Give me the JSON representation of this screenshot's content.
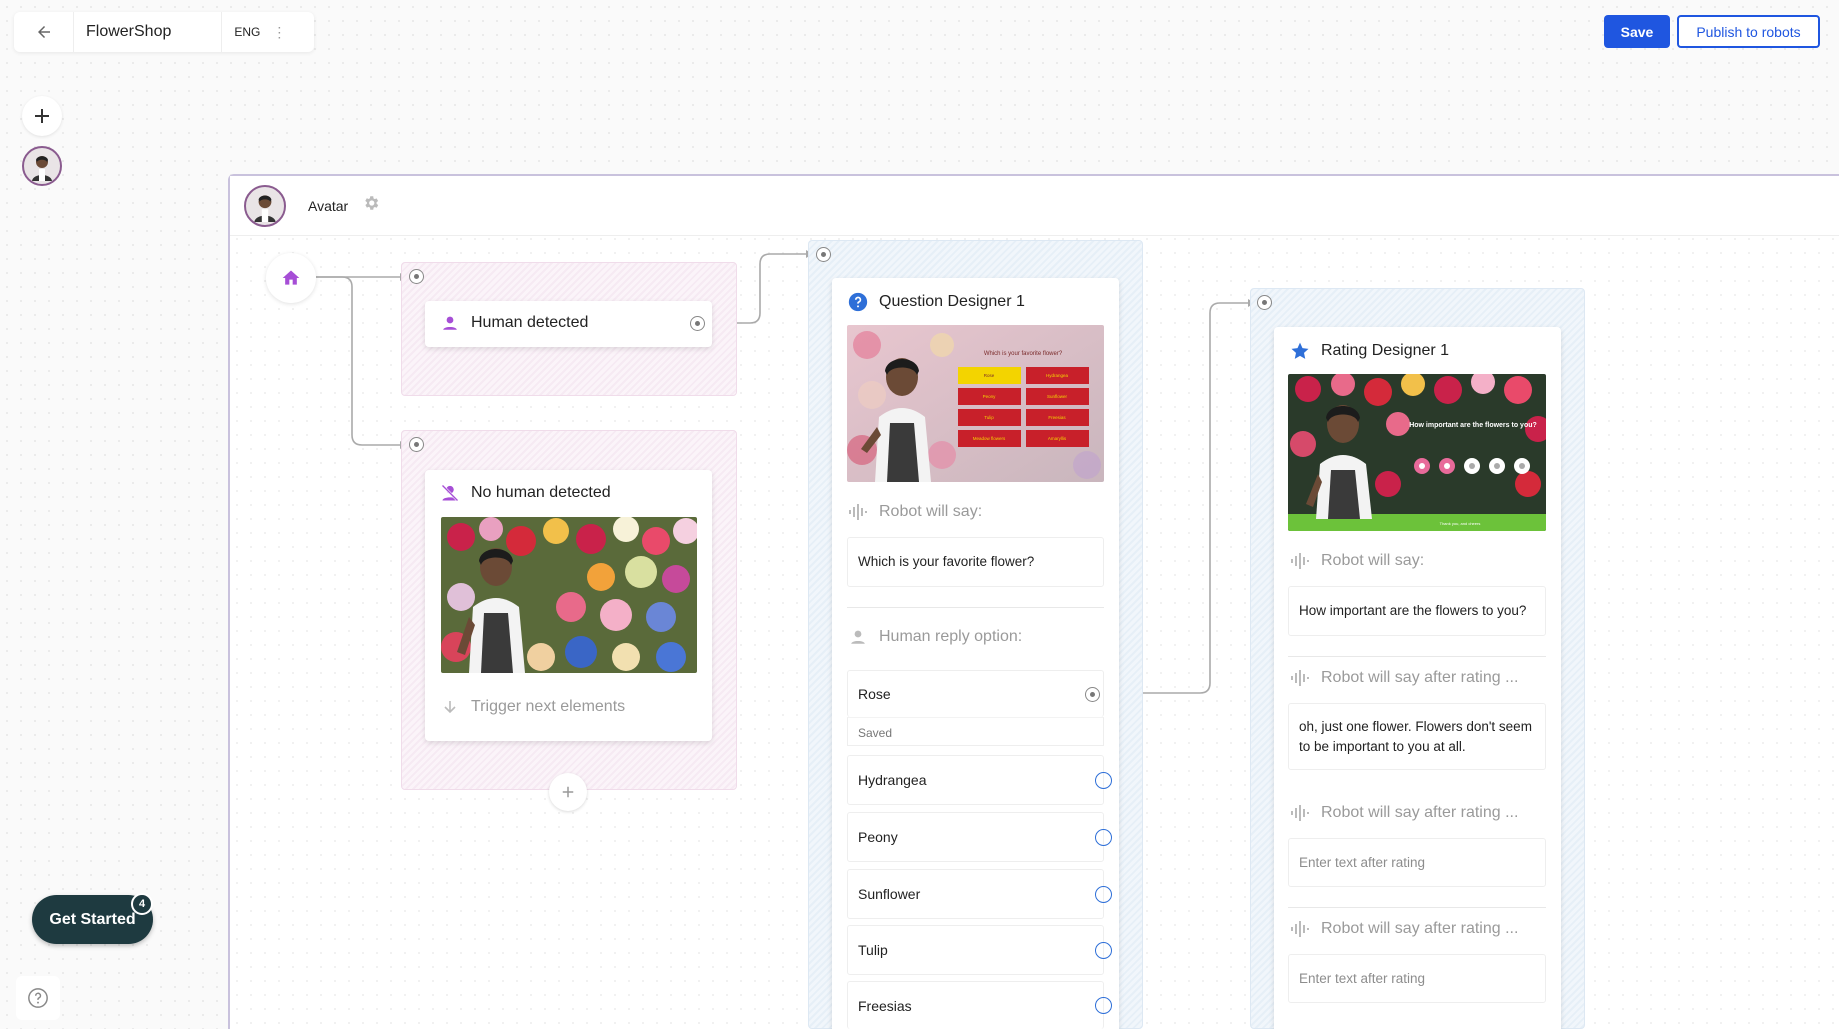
{
  "app": {
    "title": "FlowerShop",
    "language": "ENG",
    "more_glyph": "⋮",
    "save_label": "Save",
    "publish_label": "Publish to robots"
  },
  "canvas": {
    "header_label": "Avatar"
  },
  "nodes": {
    "human_detected": {
      "title": "Human detected"
    },
    "no_human_detected": {
      "title": "No human detected",
      "trigger_label": "Trigger next elements"
    },
    "question_designer": {
      "title": "Question Designer 1",
      "image": {
        "heading": "Which is your favorite flower?",
        "tiles": [
          "Rose",
          "Hydrangea",
          "Peony",
          "Sunflower",
          "Tulip",
          "Freesias",
          "Meadow flowers",
          "Amaryllis"
        ]
      },
      "robot_say_label": "Robot will say:",
      "robot_say_text": "Which is your favorite flower?",
      "human_reply_label": "Human reply option:",
      "options": [
        "Rose",
        "Hydrangea",
        "Peony",
        "Sunflower",
        "Tulip",
        "Freesias"
      ],
      "saved_label": "Saved"
    },
    "rating_designer": {
      "title": "Rating Designer 1",
      "image": {
        "heading": "How important are the flowers to you?",
        "footer": "Thank you, and cheers"
      },
      "robot_say_label": "Robot will say:",
      "robot_say_text": "How important are the flowers to you?",
      "after_rating_label": "Robot will say after rating ...",
      "after_rating_1_text": "oh, just one flower. Flowers don't seem to be important to you at all.",
      "after_rating_placeholder": "Enter text after rating"
    }
  },
  "get_started": {
    "label": "Get Started",
    "count": "4"
  },
  "colors": {
    "primary": "#1f56e0",
    "accent_purple": "#a64ed6",
    "question_blue": "#2e6fd8",
    "dark_pill": "#1e3a40",
    "canvas_border": "#c9c2dd"
  },
  "icons": [
    "back-arrow-icon",
    "plus-icon",
    "avatar-icon",
    "gear-icon",
    "home-icon",
    "person-icon",
    "person-off-icon",
    "question-icon",
    "star-icon",
    "sound-wave-icon",
    "arrow-down-icon",
    "help-icon"
  ]
}
